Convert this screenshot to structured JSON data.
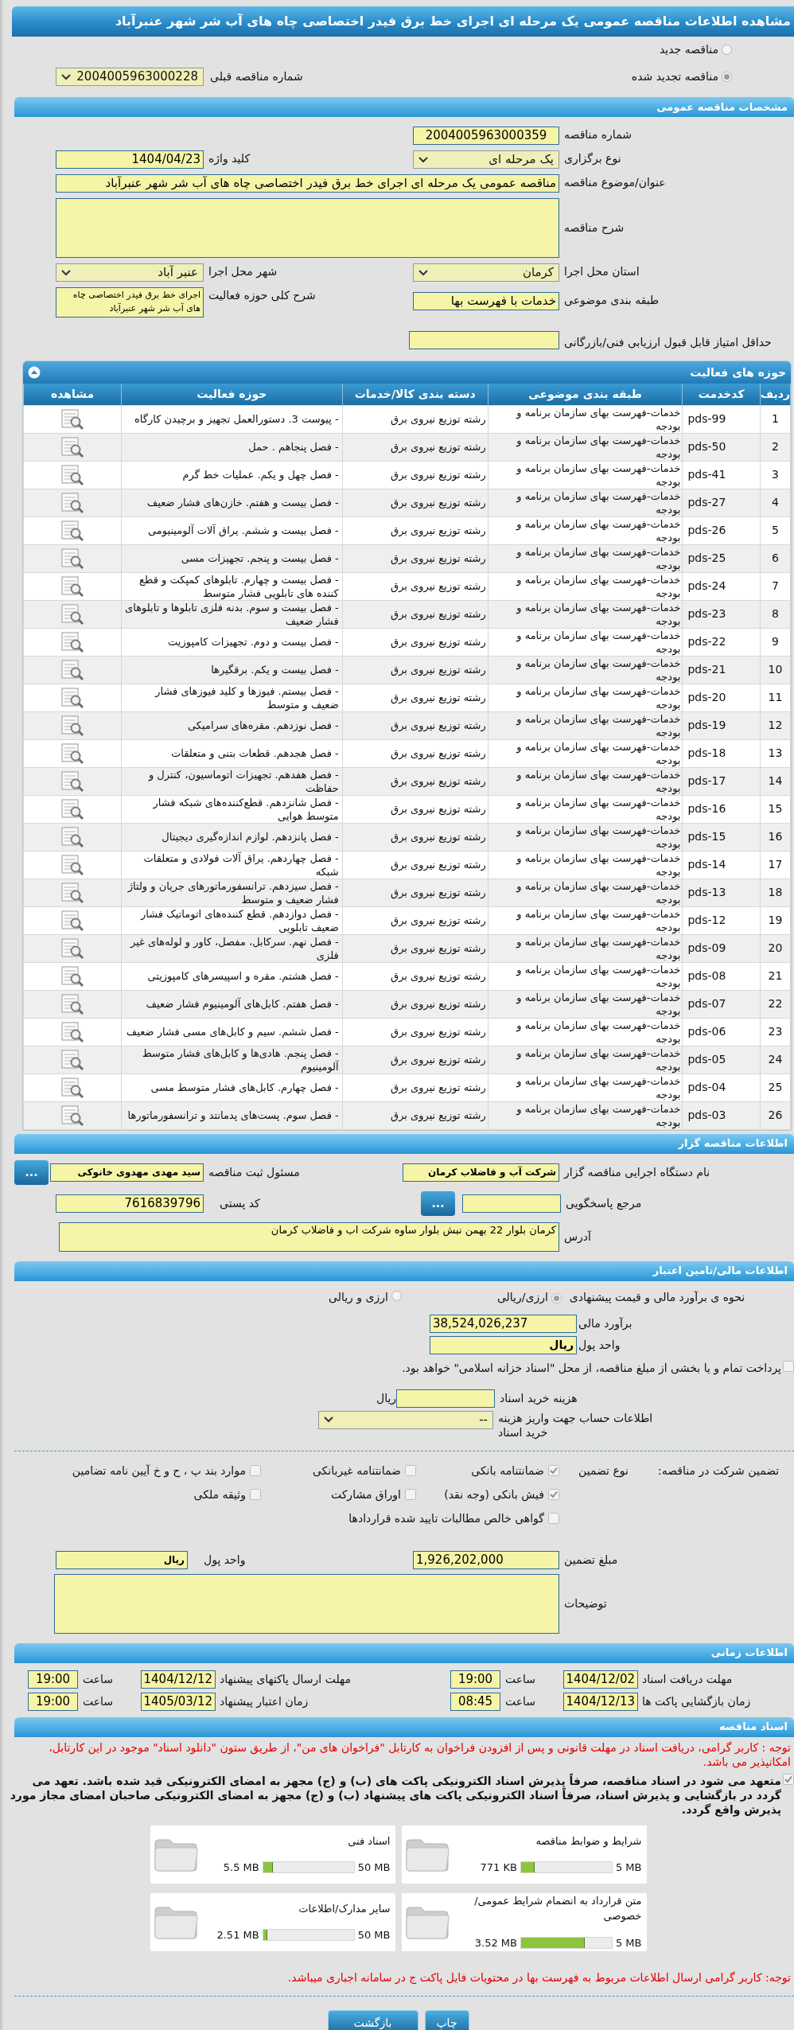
{
  "title": "مشاهده اطلاعات مناقصه عمومی یک مرحله ای اجرای خط برق فیدر اختصاصی چاه های آب شر شهر عنبرآباد",
  "tender_type": {
    "options": [
      {
        "label": "مناقصه جدید",
        "selected": false
      },
      {
        "label": "مناقصه تجدید شده",
        "selected": true
      }
    ],
    "previous": {
      "label": "شماره مناقصه قبلی",
      "value": "2004005963000228"
    }
  },
  "general": {
    "header": "مشخصات مناقصه عمومی",
    "tender_number": {
      "label": "شماره مناقصه",
      "value": "2004005963000359"
    },
    "holding_type": {
      "label": "نوع برگزاری",
      "value": "یک مرحله ای"
    },
    "keyword": {
      "label": "کلید واژه",
      "value": "1404/04/23"
    },
    "subject": {
      "label": "عنوان/موضوع مناقصه",
      "value": "مناقصه عمومی یک مرحله ای اجرای خط برق فیدر اختصاصی چاه های آب شر شهر عنبرآباد"
    },
    "description": {
      "label": "شرح مناقصه"
    },
    "province": {
      "label": "استان محل اجرا",
      "value": "کرمان"
    },
    "city": {
      "label": "شهر محل اجرا",
      "value": "عنبر آباد"
    },
    "category": {
      "label": "طبقه بندی موضوعی",
      "value": "خدمات با فهرست بها"
    },
    "activity_scope": {
      "label": "شرح کلی حوزه فعالیت",
      "value": "اجرای خط برق فیدر اختصاصی چاه های آب شر شهر عنبرآباد"
    },
    "min_score": {
      "label": "حداقل امتیاز قابل قبول ارزیابی فنی/بازرگانی"
    }
  },
  "activities": {
    "header": "حوزه های فعالیت",
    "columns": [
      "ردیف",
      "کدخدمت",
      "طبقه بندی موضوعی",
      "دسته بندی کالا/خدمات",
      "حوزه فعالیت",
      "مشاهده"
    ],
    "rows": [
      {
        "index": "1",
        "code": "pds-99",
        "category": "خدمات-فهرست بهای سازمان برنامه و بودجه",
        "group": "رشته توزیع نیروی برق",
        "scope": "- پیوست 3. دستورالعمل تجهیز و برچیدن کارگاه"
      },
      {
        "index": "2",
        "code": "pds-50",
        "category": "خدمات-فهرست بهای سازمان برنامه و بودجه",
        "group": "رشته توزیع نیروی برق",
        "scope": "- فصل پنجاهم . حمل"
      },
      {
        "index": "3",
        "code": "pds-41",
        "category": "خدمات-فهرست بهای سازمان برنامه و بودجه",
        "group": "رشته توزیع نیروی برق",
        "scope": "- فصل چهل و یکم. عملیات خط گرم"
      },
      {
        "index": "4",
        "code": "pds-27",
        "category": "خدمات-فهرست بهای سازمان برنامه و بودجه",
        "group": "رشته توزیع نیروی برق",
        "scope": "- فصل بیست و هفتم. خازن‌های فشار ضعیف"
      },
      {
        "index": "5",
        "code": "pds-26",
        "category": "خدمات-فهرست بهای سازمان برنامه و بودجه",
        "group": "رشته توزیع نیروی برق",
        "scope": "- فصل بیست و ششم. یراق آلات آلومینیومی"
      },
      {
        "index": "6",
        "code": "pds-25",
        "category": "خدمات-فهرست بهای سازمان برنامه و بودجه",
        "group": "رشته توزیع نیروی برق",
        "scope": "- فصل بیست و پنجم. تجهیزات مسی"
      },
      {
        "index": "7",
        "code": "pds-24",
        "category": "خدمات-فهرست بهای سازمان برنامه و بودجه",
        "group": "رشته توزیع نیروی برق",
        "scope": "- فصل بیست و چهارم. تابلوهای کمپکت و قطع کننده های تابلویی فشار متوسط"
      },
      {
        "index": "8",
        "code": "pds-23",
        "category": "خدمات-فهرست بهای سازمان برنامه و بودجه",
        "group": "رشته توزیع نیروی برق",
        "scope": "- فصل بیست و سوم. بدنه فلزی تابلوها و تابلوهای فشار ضعیف"
      },
      {
        "index": "9",
        "code": "pds-22",
        "category": "خدمات-فهرست بهای سازمان برنامه و بودجه",
        "group": "رشته توزیع نیروی برق",
        "scope": "- فصل بیست و دوم. تجهیزات کامپوزیت"
      },
      {
        "index": "10",
        "code": "pds-21",
        "category": "خدمات-فهرست بهای سازمان برنامه و بودجه",
        "group": "رشته توزیع نیروی برق",
        "scope": "- فصل بیست و یکم. برقگیرها"
      },
      {
        "index": "11",
        "code": "pds-20",
        "category": "خدمات-فهرست بهای سازمان برنامه و بودجه",
        "group": "رشته توزیع نیروی برق",
        "scope": "- فصل بیستم. فیوزها و کلید فیوزهای فشار ضعیف و متوسط"
      },
      {
        "index": "12",
        "code": "pds-19",
        "category": "خدمات-فهرست بهای سازمان برنامه و بودجه",
        "group": "رشته توزیع نیروی برق",
        "scope": "- فصل نوزدهم. مقره‌های سرامیکی"
      },
      {
        "index": "13",
        "code": "pds-18",
        "category": "خدمات-فهرست بهای سازمان برنامه و بودجه",
        "group": "رشته توزیع نیروی برق",
        "scope": "- فصل هجدهم. قطعات بتنی و متعلقات"
      },
      {
        "index": "14",
        "code": "pds-17",
        "category": "خدمات-فهرست بهای سازمان برنامه و بودجه",
        "group": "رشته توزیع نیروی برق",
        "scope": "- فصل هفدهم. تجهیزات اتوماسیون، کنترل و حفاظت"
      },
      {
        "index": "15",
        "code": "pds-16",
        "category": "خدمات-فهرست بهای سازمان برنامه و بودجه",
        "group": "رشته توزیع نیروی برق",
        "scope": "- فصل شانزدهم. قطع‌کننده‌های شبکه فشار متوسط هوایی"
      },
      {
        "index": "16",
        "code": "pds-15",
        "category": "خدمات-فهرست بهای سازمان برنامه و بودجه",
        "group": "رشته توزیع نیروی برق",
        "scope": "- فصل پانزدهم. لوازم اندازه‌گیری دیجیتال"
      },
      {
        "index": "17",
        "code": "pds-14",
        "category": "خدمات-فهرست بهای سازمان برنامه و بودجه",
        "group": "رشته توزیع نیروی برق",
        "scope": "- فصل چهاردهم. یراق آلات فولادی و متعلقات شبکه"
      },
      {
        "index": "18",
        "code": "pds-13",
        "category": "خدمات-فهرست بهای سازمان برنامه و بودجه",
        "group": "رشته توزیع نیروی برق",
        "scope": "- فصل سیزدهم. ترانسفورماتورهای جریان و ولتاژ فشار ضعیف و متوسط"
      },
      {
        "index": "19",
        "code": "pds-12",
        "category": "خدمات-فهرست بهای سازمان برنامه و بودجه",
        "group": "رشته توزیع نیروی برق",
        "scope": "- فصل دوازدهم. قطع کننده‌های اتوماتیک فشار ضعیف تابلویی"
      },
      {
        "index": "20",
        "code": "pds-09",
        "category": "خدمات-فهرست بهای سازمان برنامه و بودجه",
        "group": "رشته توزیع نیروی برق",
        "scope": "- فصل نهم. سرکابل، مفصل، کاور و لوله‌های غیر فلزی"
      },
      {
        "index": "21",
        "code": "pds-08",
        "category": "خدمات-فهرست بهای سازمان برنامه و بودجه",
        "group": "رشته توزیع نیروی برق",
        "scope": "- فصل هشتم. مقره و اسپیسرهای کامپوزیتی"
      },
      {
        "index": "22",
        "code": "pds-07",
        "category": "خدمات-فهرست بهای سازمان برنامه و بودجه",
        "group": "رشته توزیع نیروی برق",
        "scope": "- فصل هفتم. کابل‌های آلومینیوم فشار ضعیف"
      },
      {
        "index": "23",
        "code": "pds-06",
        "category": "خدمات-فهرست بهای سازمان برنامه و بودجه",
        "group": "رشته توزیع نیروی برق",
        "scope": "- فصل ششم. سیم و کابل‌های مسی فشار ضعیف"
      },
      {
        "index": "24",
        "code": "pds-05",
        "category": "خدمات-فهرست بهای سازمان برنامه و بودجه",
        "group": "رشته توزیع نیروی برق",
        "scope": "- فصل پنجم. هادی‌ها و کابل‌های فشار متوسط آلومینیوم"
      },
      {
        "index": "25",
        "code": "pds-04",
        "category": "خدمات-فهرست بهای سازمان برنامه و بودجه",
        "group": "رشته توزیع نیروی برق",
        "scope": "- فصل چهارم. کابل‌های فشار متوسط مسی"
      },
      {
        "index": "26",
        "code": "pds-03",
        "category": "خدمات-فهرست بهای سازمان برنامه و بودجه",
        "group": "رشته توزیع نیروی برق",
        "scope": "- فصل سوم. پست‌های پدمانتد و ترانسفورماتورها"
      }
    ]
  },
  "organizer": {
    "header": "اطلاعات مناقصه گزار",
    "org_name": {
      "label": "نام دستگاه اجرایی مناقصه گزار",
      "value": "شرکت آب و فاضلاب کرمان"
    },
    "registrar": {
      "label": "مسئول ثبت مناقصه",
      "value": "سید مهدی مهدوی خانوکی",
      "button": "..."
    },
    "reference": {
      "label": "مرجع پاسخگویی",
      "button": "..."
    },
    "postal_code": {
      "label": "کد پستی",
      "value": "7616839796"
    },
    "address": {
      "label": "آدرس",
      "value": "کرمان بلوار 22 بهمن نبش بلوار ساوه شرکت اب و فاضلاب کرمان"
    }
  },
  "finance": {
    "header": "اطلاعات مالی/تامین اعتبار",
    "method": {
      "label": "نحوه ی برآورد مالی و قیمت پیشنهادی",
      "options": [
        {
          "label": "ارزی/ریالی",
          "selected": true
        },
        {
          "label": "ارزی و ریالی",
          "selected": false
        }
      ]
    },
    "estimate": {
      "label": "برآورد مالی",
      "value": "38,524,026,237"
    },
    "currency": {
      "label": "واحد پول",
      "value": "ریال"
    },
    "treasury": {
      "label": "پرداخت تمام و یا بخشی از مبلغ مناقصه، از محل \"اسناد خزانه اسلامی\" خواهد بود.",
      "checked": false
    },
    "doc_fee": {
      "label": "هزینه خرید اسناد",
      "unit": "ریال"
    },
    "account": {
      "label": "اطلاعات حساب جهت واریز هزینه خرید اسناد",
      "value": "--"
    }
  },
  "guarantee": {
    "label": "تضمین شرکت در مناقصه:",
    "type_label": "نوع تضمین",
    "options": [
      {
        "label": "ضمانتنامه بانکی",
        "checked": true
      },
      {
        "label": "ضمانتنامه غیربانکی",
        "checked": false
      },
      {
        "label": "موارد بند پ ، ح و خ آیین نامه تضامین",
        "checked": false
      },
      {
        "label": "فیش بانکی (وجه نقد)",
        "checked": true
      },
      {
        "label": "اوراق مشارکت",
        "checked": false
      },
      {
        "label": "وثیقه ملکی",
        "checked": false
      },
      {
        "label": "گواهی خالص مطالبات تایید شده قراردادها",
        "checked": false
      }
    ],
    "amount": {
      "label": "مبلغ تضمین",
      "value": "1,926,202,000"
    },
    "currency": {
      "label": "واحد پول",
      "value": "ریال"
    },
    "notes": {
      "label": "توضیحات"
    }
  },
  "schedule": {
    "header": "اطلاعات زمانی",
    "items": [
      {
        "label": "مهلت دریافت اسناد",
        "date": "1404/12/02",
        "time_label": "ساعت",
        "time": "19:00"
      },
      {
        "label": "مهلت ارسال پاکتهای پیشنهاد",
        "date": "1404/12/12",
        "time_label": "ساعت",
        "time": "19:00"
      },
      {
        "label": "زمان بازگشایی پاکت ها",
        "date": "1404/12/13",
        "time_label": "ساعت",
        "time": "08:45"
      },
      {
        "label": "زمان اعتبار پیشنهاد",
        "date": "1405/03/12",
        "time_label": "ساعت",
        "time": "19:00"
      }
    ]
  },
  "documents": {
    "header": "اسناد مناقصه",
    "notice": "توجه : کاربر گرامی، دریافت اسناد در مهلت قانونی و پس از افزودن فراخوان به کارتابل \"فراخوان های من\"، از طریق ستون \"دانلود اسناد\" موجود در این کارتابل، امکانپذیر می باشد.",
    "commitment": {
      "label": "متعهد می شود در اسناد مناقصه، صرفاً پذیرش اسناد الکترونیکی پاکت های (ب) و (ج) مجهز به امضای الکترونیکی قید شده باشد. تعهد می گردد در بازگشایی و پذیرش اسناد، صرفاً اسناد الکترونیکی پاکت های پیشنهاد (ب) و (ج) مجهز به امضای الکترونیکی صاحبان امضای مجاز مورد پذیرش واقع گردد.",
      "checked": true
    },
    "files": [
      {
        "name": "شرایط و ضوابط مناقصه",
        "size": "771 KB",
        "max": "5 MB",
        "level": 0.15
      },
      {
        "name": "اسناد فنی",
        "size": "5.5 MB",
        "max": "50 MB",
        "level": 0.11
      },
      {
        "name": "متن قرارداد به انضمام شرایط عمومی/خصوصی",
        "size": "3.52 MB",
        "max": "5 MB",
        "level": 0.7
      },
      {
        "name": "سایر مدارک/اطلاعات",
        "size": "2.51 MB",
        "max": "50 MB",
        "level": 0.05
      }
    ],
    "final_notice": "توجه: کاربر گرامی ارسال اطلاعات مربوط به فهرست بها در محتویات فایل پاکت ج در سامانه اجباری میباشد."
  },
  "buttons": [
    "چاپ",
    "بازگشت"
  ]
}
